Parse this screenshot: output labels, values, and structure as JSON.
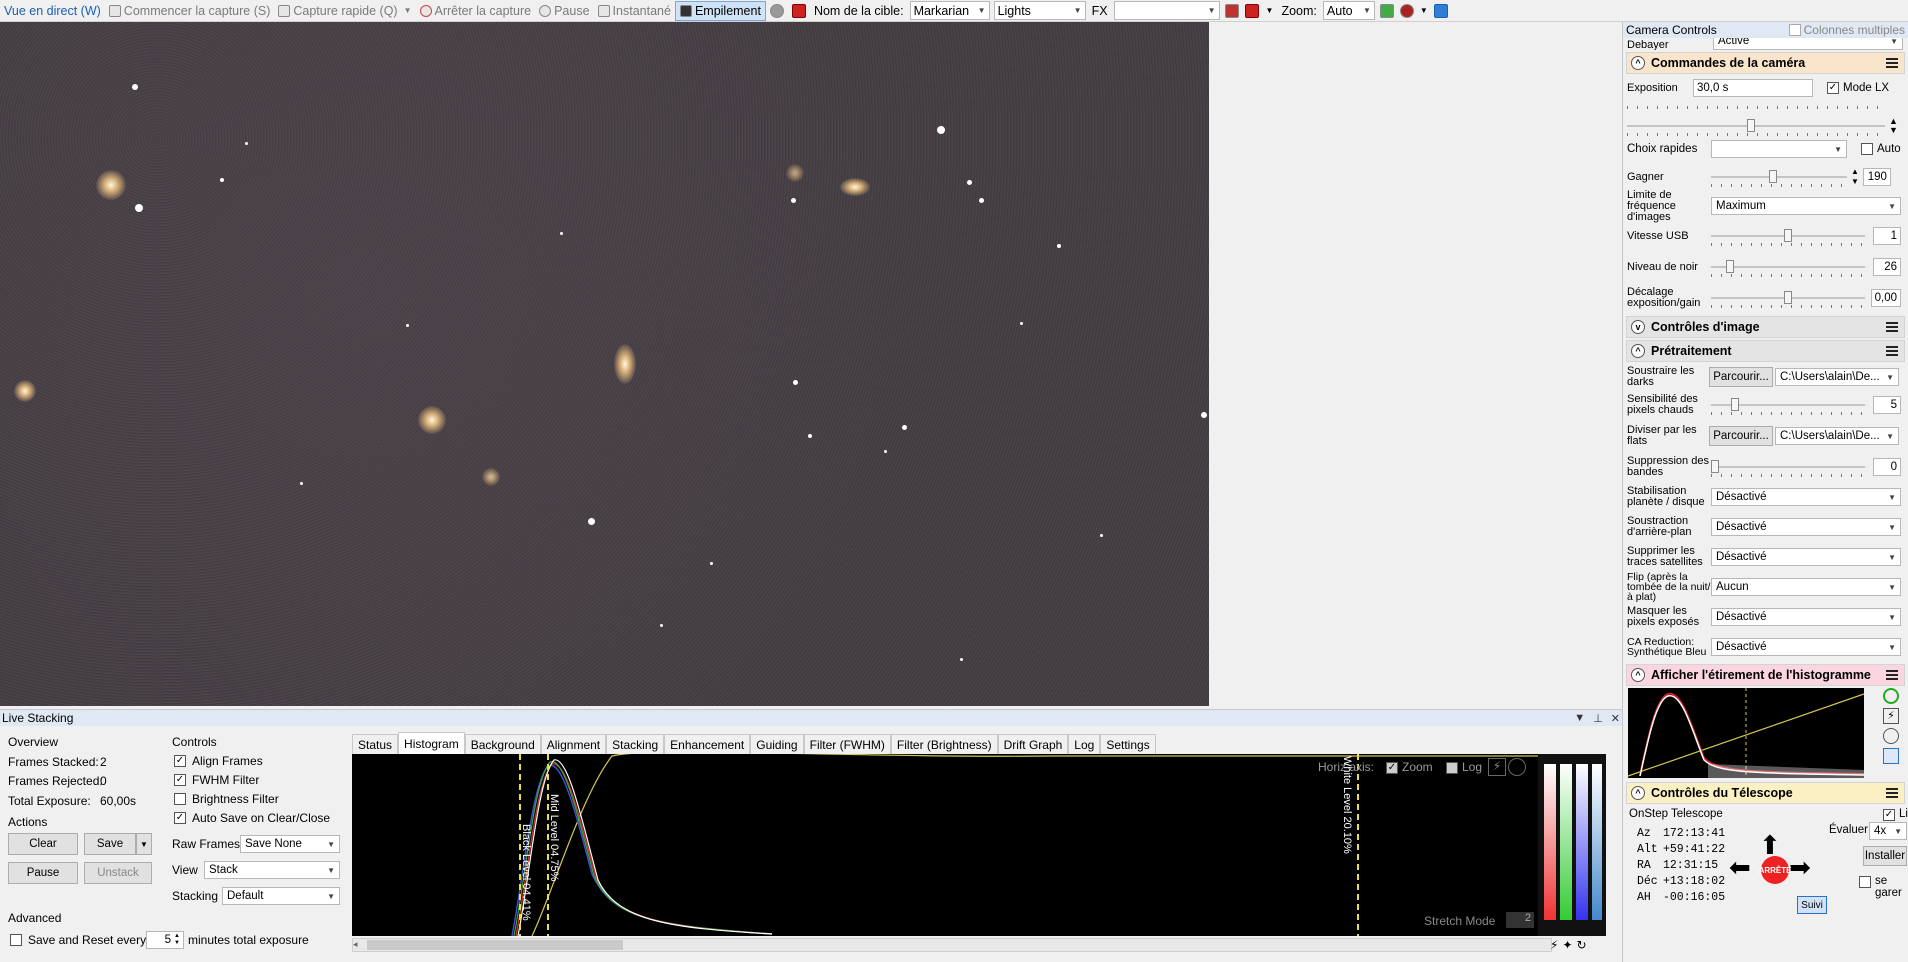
{
  "toolbar": {
    "live_view": "Vue en direct (W)",
    "start_capture": "Commencer la capture (S)",
    "quick_capture": "Capture rapide (Q)",
    "stop_capture": "Arrêter la capture",
    "pause": "Pause",
    "snapshot": "Instantané",
    "stacking": "Empilement",
    "target_name_label": "Nom de la cible:",
    "target_name_value": "Markarian",
    "frame_type_value": "Lights",
    "fx_label": "FX",
    "fx_value": "",
    "zoom_label": "Zoom:",
    "zoom_value": "Auto"
  },
  "right_panel": {
    "title": "Camera Controls",
    "multi_columns_label": "Colonnes multiples",
    "debayer_label": "Debayer",
    "debayer_value": "Activé",
    "camera_section": {
      "title": "Commandes de la caméra",
      "exposure_label": "Exposition",
      "exposure_value": "30,0 s",
      "lx_mode_label": "Mode LX",
      "quick_choice_label": "Choix rapides",
      "quick_choice_value": "",
      "auto_label": "Auto",
      "gain_label": "Gagner",
      "gain_value": "190",
      "gain_level": 0.45,
      "framerate_label": "Limite de fréquence d'images",
      "framerate_value": "Maximum",
      "usb_label": "Vitesse USB",
      "usb_value": "1",
      "usb_level": 0.5,
      "black_label": "Niveau de noir",
      "black_value": "26",
      "black_level": 0.1,
      "exp_gain_label": "Décalage exposition/gain",
      "exp_gain_value": "0,00",
      "exp_gain_level": 0.5
    },
    "image_controls_title": "Contrôles d'image",
    "preprocessing": {
      "title": "Prétraitement",
      "darks_label": "Soustraire les darks",
      "browse_label": "Parcourir...",
      "darks_path": "C:\\Users\\alain\\De...",
      "hot_pixel_label": "Sensibilité des pixels chauds",
      "hot_pixel_value": "5",
      "flats_label": "Diviser par les flats",
      "flats_path": "C:\\Users\\alain\\De...",
      "banding_label": "Suppression des bandes",
      "banding_value": "0",
      "planet_label": "Stabilisation planète / disque",
      "planet_value": "Désactivé",
      "background_label": "Soustraction d'arrière-plan",
      "background_value": "Désactivé",
      "satellite_label": "Supprimer les traces satellites",
      "satellite_value": "Désactivé",
      "flip_label": "Flip (après la tombée de la nuit/à plat)",
      "flip_value": "Aucun",
      "mask_label": "Masquer les pixels exposés",
      "mask_value": "Désactivé",
      "ca_label": "CA Reduction: Synthétique Bleu",
      "ca_value": "Désactivé"
    },
    "histogram_section": {
      "title": "Afficher l'étirement de l'histogramme"
    },
    "telescope": {
      "title": "Contrôles du Télescope",
      "linked_label": "Lié",
      "name": "OnStep Telescope",
      "evaluate_label": "Évaluer:",
      "evaluate_value": "4x",
      "install_label": "Installer",
      "park_label": "se garer",
      "stop_label": "ARRÊTE",
      "follow_label": "Suivi",
      "coords": [
        {
          "label": "Az",
          "value": "172:13:41"
        },
        {
          "label": "Alt",
          "value": "+59:41:22"
        },
        {
          "label": "RA",
          "value": "12:31:15"
        },
        {
          "label": "Déc",
          "value": "+13:18:02"
        },
        {
          "label": "AH",
          "value": "-00:16:05"
        }
      ]
    }
  },
  "live_stacking": {
    "title": "Live Stacking",
    "overview_title": "Overview",
    "frames_stacked_label": "Frames Stacked:",
    "frames_stacked_value": "2",
    "frames_rejected_label": "Frames Rejected:",
    "frames_rejected_value": "0",
    "total_exposure_label": "Total Exposure:",
    "total_exposure_value": "60,00s",
    "actions_title": "Actions",
    "clear_label": "Clear",
    "save_label": "Save",
    "pause_label": "Pause",
    "unstack_label": "Unstack",
    "advanced_title": "Advanced",
    "save_reset_label": "Save and Reset every",
    "save_reset_value": "5",
    "save_reset_suffix": "minutes total exposure",
    "controls_title": "Controls",
    "align_frames": "Align Frames",
    "fwhm_filter": "FWHM Filter",
    "brightness_filter": "Brightness Filter",
    "auto_save": "Auto Save on Clear/Close",
    "raw_frames_label": "Raw Frames",
    "raw_frames_value": "Save None",
    "view_label": "View",
    "view_value": "Stack",
    "stacking_label": "Stacking",
    "stacking_value": "Default",
    "tabs": [
      "Status",
      "Histogram",
      "Background",
      "Alignment",
      "Stacking",
      "Enhancement",
      "Guiding",
      "Filter (FWHM)",
      "Filter (Brightness)",
      "Drift Graph",
      "Log",
      "Settings"
    ],
    "active_tab": "Histogram",
    "histogram": {
      "horiz_axis_label": "Horiz axis:",
      "zoom_label": "Zoom",
      "log_label": "Log",
      "black_level": "Black Level 04.41%",
      "mid_level": "Mid Level 04.75%",
      "white_level": "White Level 20.10%",
      "stretch_mode_label": "Stretch Mode",
      "stretch_mode_value": "2"
    }
  }
}
